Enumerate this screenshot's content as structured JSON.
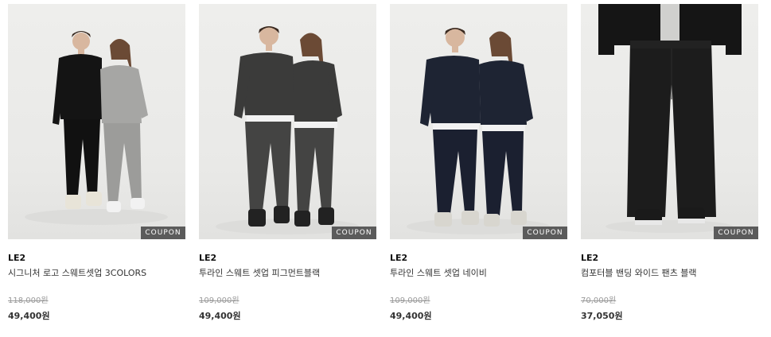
{
  "products": [
    {
      "brand": "LE2",
      "name": "시그니처 로고 스웨트셋업 3COLORS",
      "original_price": "118,000원",
      "sale_price": "49,400원",
      "badge": "COUPON",
      "colors": {
        "left_top": "#141414",
        "left_bottom": "#111111",
        "right_top": "#a6a6a4",
        "right_bottom": "#9c9c9a"
      }
    },
    {
      "brand": "LE2",
      "name": "투라인 스웨트 셋업 피그먼트블랙",
      "original_price": "109,000원",
      "sale_price": "49,400원",
      "badge": "COUPON",
      "colors": {
        "left_top": "#3b3b3a",
        "left_bottom": "#444443",
        "right_top": "#3b3b3a",
        "right_bottom": "#444443"
      }
    },
    {
      "brand": "LE2",
      "name": "투라인 스웨트 셋업 네이비",
      "original_price": "109,000원",
      "sale_price": "49,400원",
      "badge": "COUPON",
      "colors": {
        "left_top": "#1e2433",
        "left_bottom": "#1b2030",
        "right_top": "#1e2433",
        "right_bottom": "#1b2030"
      }
    },
    {
      "brand": "LE2",
      "name": "컴포터블 밴딩 와이드 팬츠 블랙",
      "original_price": "70,000원",
      "sale_price": "37,050원",
      "badge": "COUPON",
      "colors": {
        "pants": "#1c1c1c",
        "jacket": "#151515"
      }
    }
  ]
}
